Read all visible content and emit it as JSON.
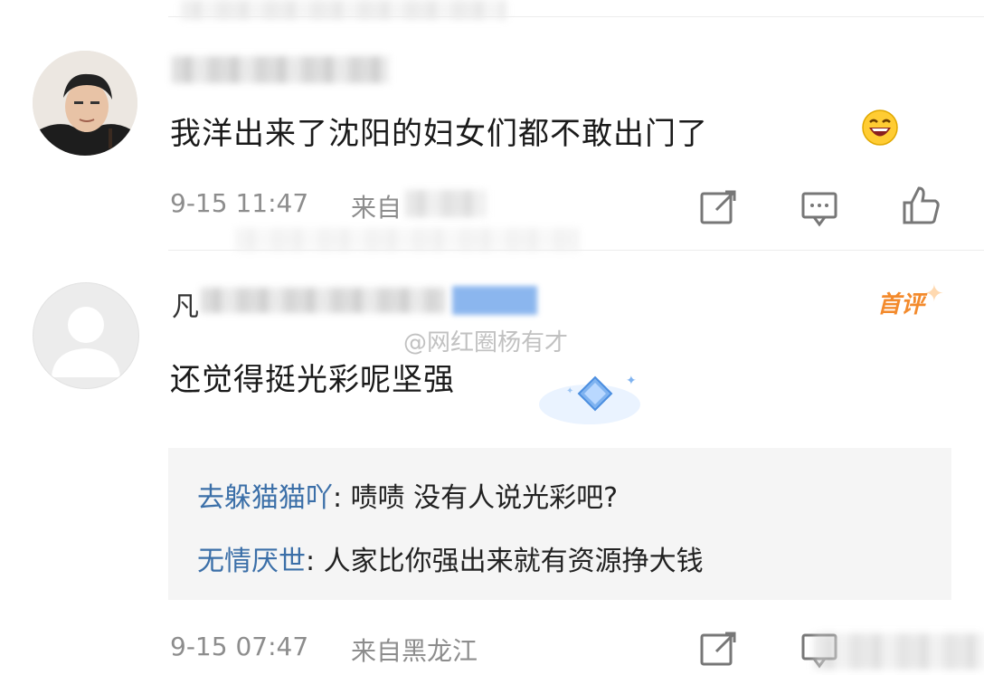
{
  "comments": [
    {
      "text": "我洋出来了沈阳的妇女们都不敢出门了",
      "date": "9-15 11:47",
      "source": "来自",
      "emoji": "laughing-face"
    },
    {
      "username_initial": "凡",
      "badge": "首评",
      "text": "还觉得挺光彩呢坚强",
      "date": "9-15 07:47",
      "source": "来自黑龙江",
      "replies": [
        {
          "name": "去躲猫猫吖",
          "text": ": 啧啧 没有人说光彩吧?"
        },
        {
          "name": "无情厌世",
          "text": ": 人家比你强出来就有资源挣大钱"
        }
      ]
    }
  ],
  "watermark": "@网红圈杨有才",
  "colors": {
    "reply_name": "#3b6fa8",
    "badge": "#f38a2c",
    "meta": "#8d8d8d"
  }
}
